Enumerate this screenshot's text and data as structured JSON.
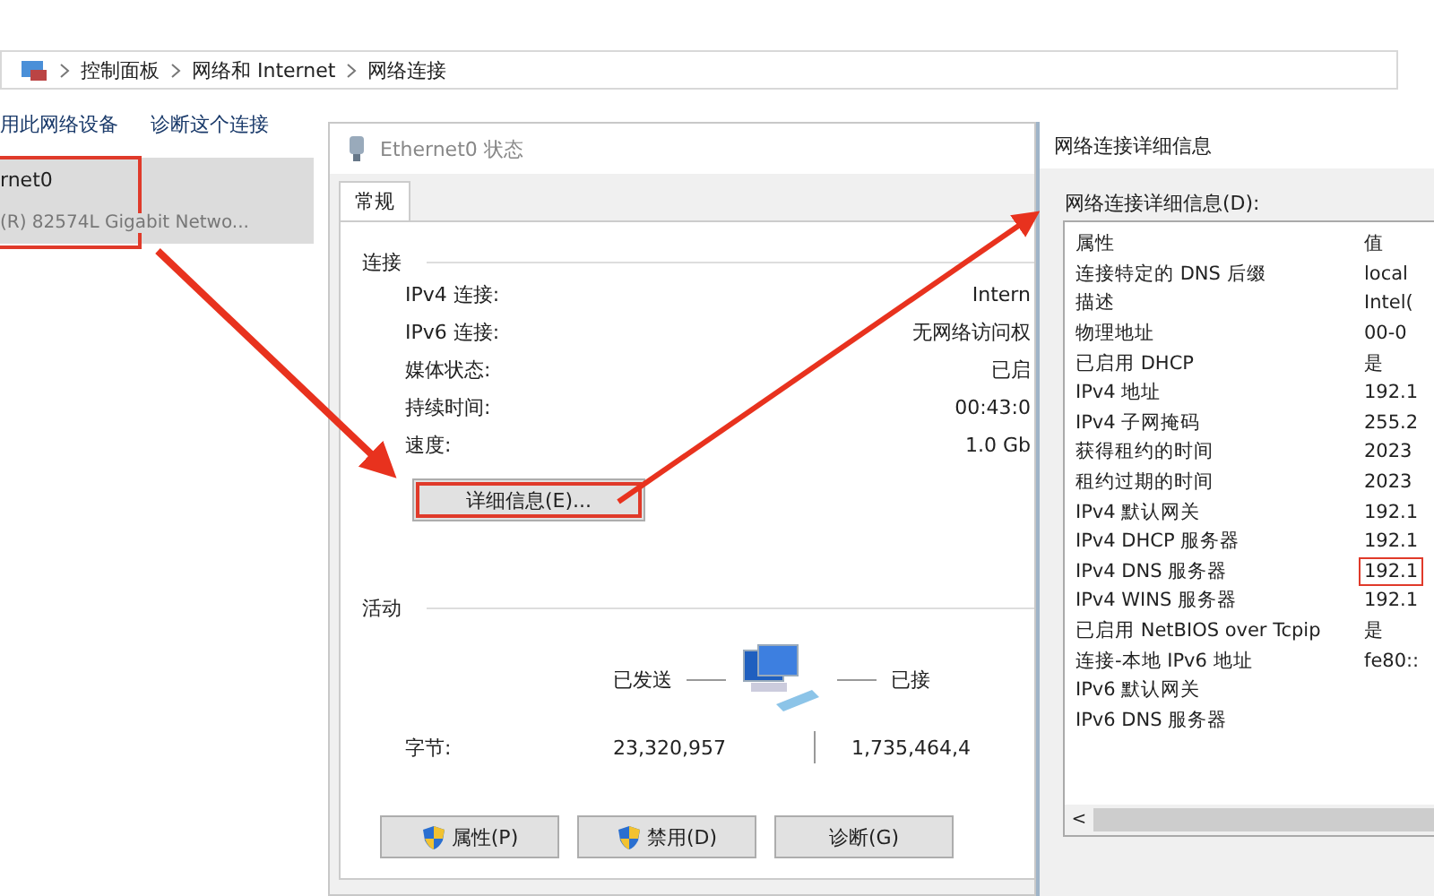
{
  "explorer": {
    "breadcrumb": [
      "控制面板",
      "网络和 Internet",
      "网络连接"
    ],
    "toolbar": [
      "用此网络设备",
      "诊断这个连接"
    ],
    "connection": {
      "name": "rnet0",
      "device": "(R) 82574L Gigabit Netwo...",
      "selected": true,
      "highlighted": true
    }
  },
  "status_window": {
    "title": "Ethernet0 状态",
    "tabs": [
      {
        "label": "常规",
        "selected": true
      }
    ],
    "connection_group": "连接",
    "fields": [
      {
        "label": "IPv4 连接:",
        "value": "Intern"
      },
      {
        "label": "IPv6 连接:",
        "value": "无网络访问权"
      },
      {
        "label": "媒体状态:",
        "value": "已启"
      },
      {
        "label": "持续时间:",
        "value": "00:43:0"
      },
      {
        "label": "速度:",
        "value": "1.0 Gb"
      }
    ],
    "details_button": {
      "label": "详细信息(E)...",
      "highlighted": true
    },
    "activity_group": "活动",
    "sent_label": "已发送",
    "received_label": "已接",
    "bytes_label": "字节:",
    "bytes_sent": "23,320,957",
    "bytes_received": "1,735,464,4",
    "buttons": [
      {
        "label": "属性(P)",
        "shield": true
      },
      {
        "label": "禁用(D)",
        "shield": true
      },
      {
        "label": "诊断(G)",
        "shield": false
      }
    ]
  },
  "details_window": {
    "title": "网络连接详细信息",
    "list_label": "网络连接详细信息(D):",
    "columns": [
      "属性",
      "值"
    ],
    "rows": [
      {
        "property": "连接特定的 DNS 后缀",
        "value": "local",
        "highlighted": false
      },
      {
        "property": "描述",
        "value": "Intel(",
        "highlighted": false
      },
      {
        "property": "物理地址",
        "value": "00-0",
        "highlighted": false
      },
      {
        "property": "已启用 DHCP",
        "value": "是",
        "highlighted": false
      },
      {
        "property": "IPv4 地址",
        "value": "192.1",
        "highlighted": false
      },
      {
        "property": "IPv4 子网掩码",
        "value": "255.2",
        "highlighted": false
      },
      {
        "property": "获得租约的时间",
        "value": "2023",
        "highlighted": false
      },
      {
        "property": "租约过期的时间",
        "value": "2023",
        "highlighted": false
      },
      {
        "property": "IPv4 默认网关",
        "value": "192.1",
        "highlighted": false
      },
      {
        "property": "IPv4 DHCP 服务器",
        "value": "192.1",
        "highlighted": false
      },
      {
        "property": "IPv4 DNS 服务器",
        "value": "192.1",
        "highlighted": true
      },
      {
        "property": "IPv4 WINS 服务器",
        "value": "192.1",
        "highlighted": false
      },
      {
        "property": "已启用 NetBIOS over Tcpip",
        "value": "是",
        "highlighted": false
      },
      {
        "property": "连接-本地 IPv6 地址",
        "value": "fe80::",
        "highlighted": false
      },
      {
        "property": "IPv6 默认网关",
        "highlighted": false
      },
      {
        "property": "IPv6 DNS 服务器",
        "highlighted": false
      }
    ],
    "scroll_left": "<"
  }
}
